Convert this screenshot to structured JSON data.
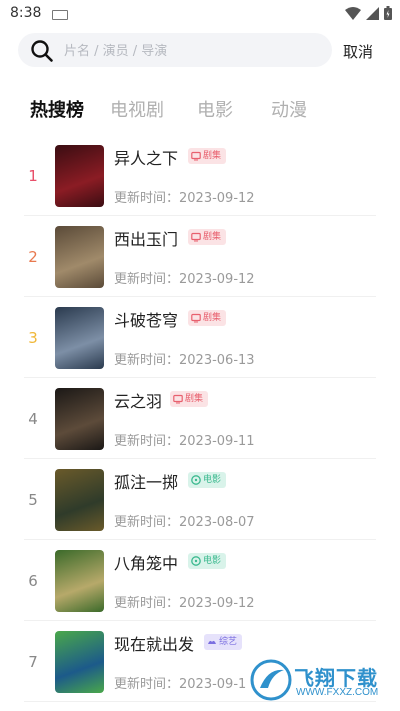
{
  "status_bar": {
    "time": "8:38"
  },
  "search": {
    "placeholder": "片名 / 演员 / 导演",
    "cancel_label": "取消"
  },
  "tabs": [
    {
      "label": "热搜榜",
      "active": true
    },
    {
      "label": "电视剧",
      "active": false
    },
    {
      "label": "电影",
      "active": false
    },
    {
      "label": "动漫",
      "active": false
    }
  ],
  "colors": {
    "rank_1": "#e84f6a",
    "rank_2": "#e8794f",
    "rank_3": "#f0b83a",
    "rank_default": "#888888",
    "badge_drama": "#e8606e",
    "badge_movie": "#3bb98f",
    "badge_variety": "#7b6fe0"
  },
  "items": [
    {
      "rank": "1",
      "title": "异人之下",
      "badge": "剧集",
      "badge_type": "drama",
      "updated": "更新时间：2023-09-12"
    },
    {
      "rank": "2",
      "title": "西出玉门",
      "badge": "剧集",
      "badge_type": "drama",
      "updated": "更新时间：2023-09-12"
    },
    {
      "rank": "3",
      "title": "斗破苍穹",
      "badge": "剧集",
      "badge_type": "drama",
      "updated": "更新时间：2023-06-13"
    },
    {
      "rank": "4",
      "title": "云之羽",
      "badge": "剧集",
      "badge_type": "drama",
      "updated": "更新时间：2023-09-11"
    },
    {
      "rank": "5",
      "title": "孤注一掷",
      "badge": "电影",
      "badge_type": "movie",
      "updated": "更新时间：2023-08-07"
    },
    {
      "rank": "6",
      "title": "八角笼中",
      "badge": "电影",
      "badge_type": "movie",
      "updated": "更新时间：2023-09-12"
    },
    {
      "rank": "7",
      "title": "现在就出发",
      "badge": "综艺",
      "badge_type": "variety",
      "updated": "更新时间：2023-09-1"
    }
  ],
  "watermark": {
    "text": "飞翔下载",
    "url": "WWW.FXXZ.COM"
  }
}
